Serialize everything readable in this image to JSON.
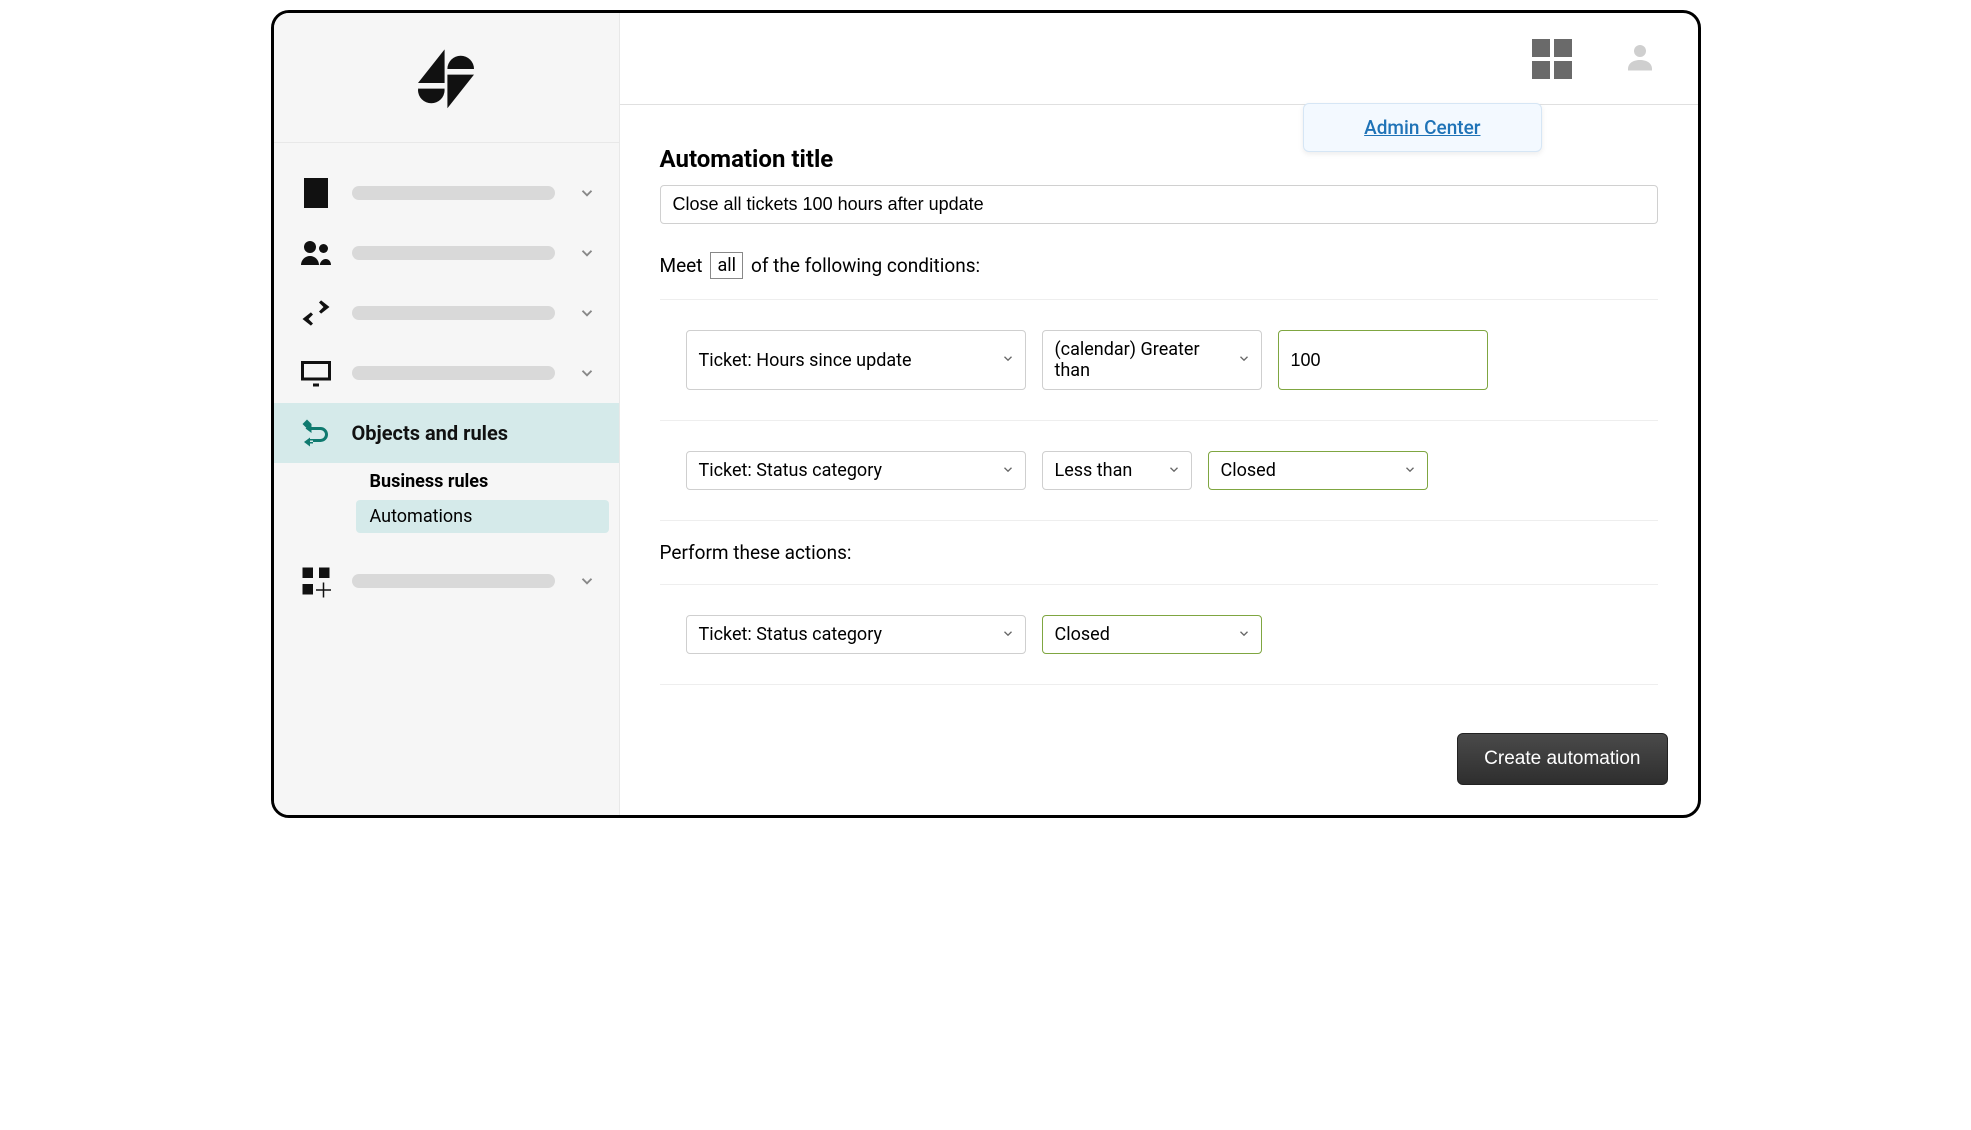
{
  "header": {
    "admin_center_label": "Admin Center"
  },
  "sidebar": {
    "active_label": "Objects and rules",
    "sub_items": [
      {
        "label": "Business rules",
        "bold": true,
        "selected": false
      },
      {
        "label": "Automations",
        "bold": false,
        "selected": true
      }
    ]
  },
  "form": {
    "title_label": "Automation title",
    "title_value": "Close all tickets 100 hours after update",
    "conditions_prefix": "Meet",
    "conditions_quantifier": "all",
    "conditions_suffix": "of the following conditions:",
    "conditions": [
      {
        "field": "Ticket: Hours since update",
        "operator": "(calendar) Greater than",
        "value": "100",
        "value_type": "input"
      },
      {
        "field": "Ticket: Status category",
        "operator": "Less than",
        "value": "Closed",
        "value_type": "select"
      }
    ],
    "actions_label": "Perform these actions:",
    "actions": [
      {
        "field": "Ticket: Status category",
        "value": "Closed"
      }
    ],
    "submit_label": "Create automation"
  }
}
